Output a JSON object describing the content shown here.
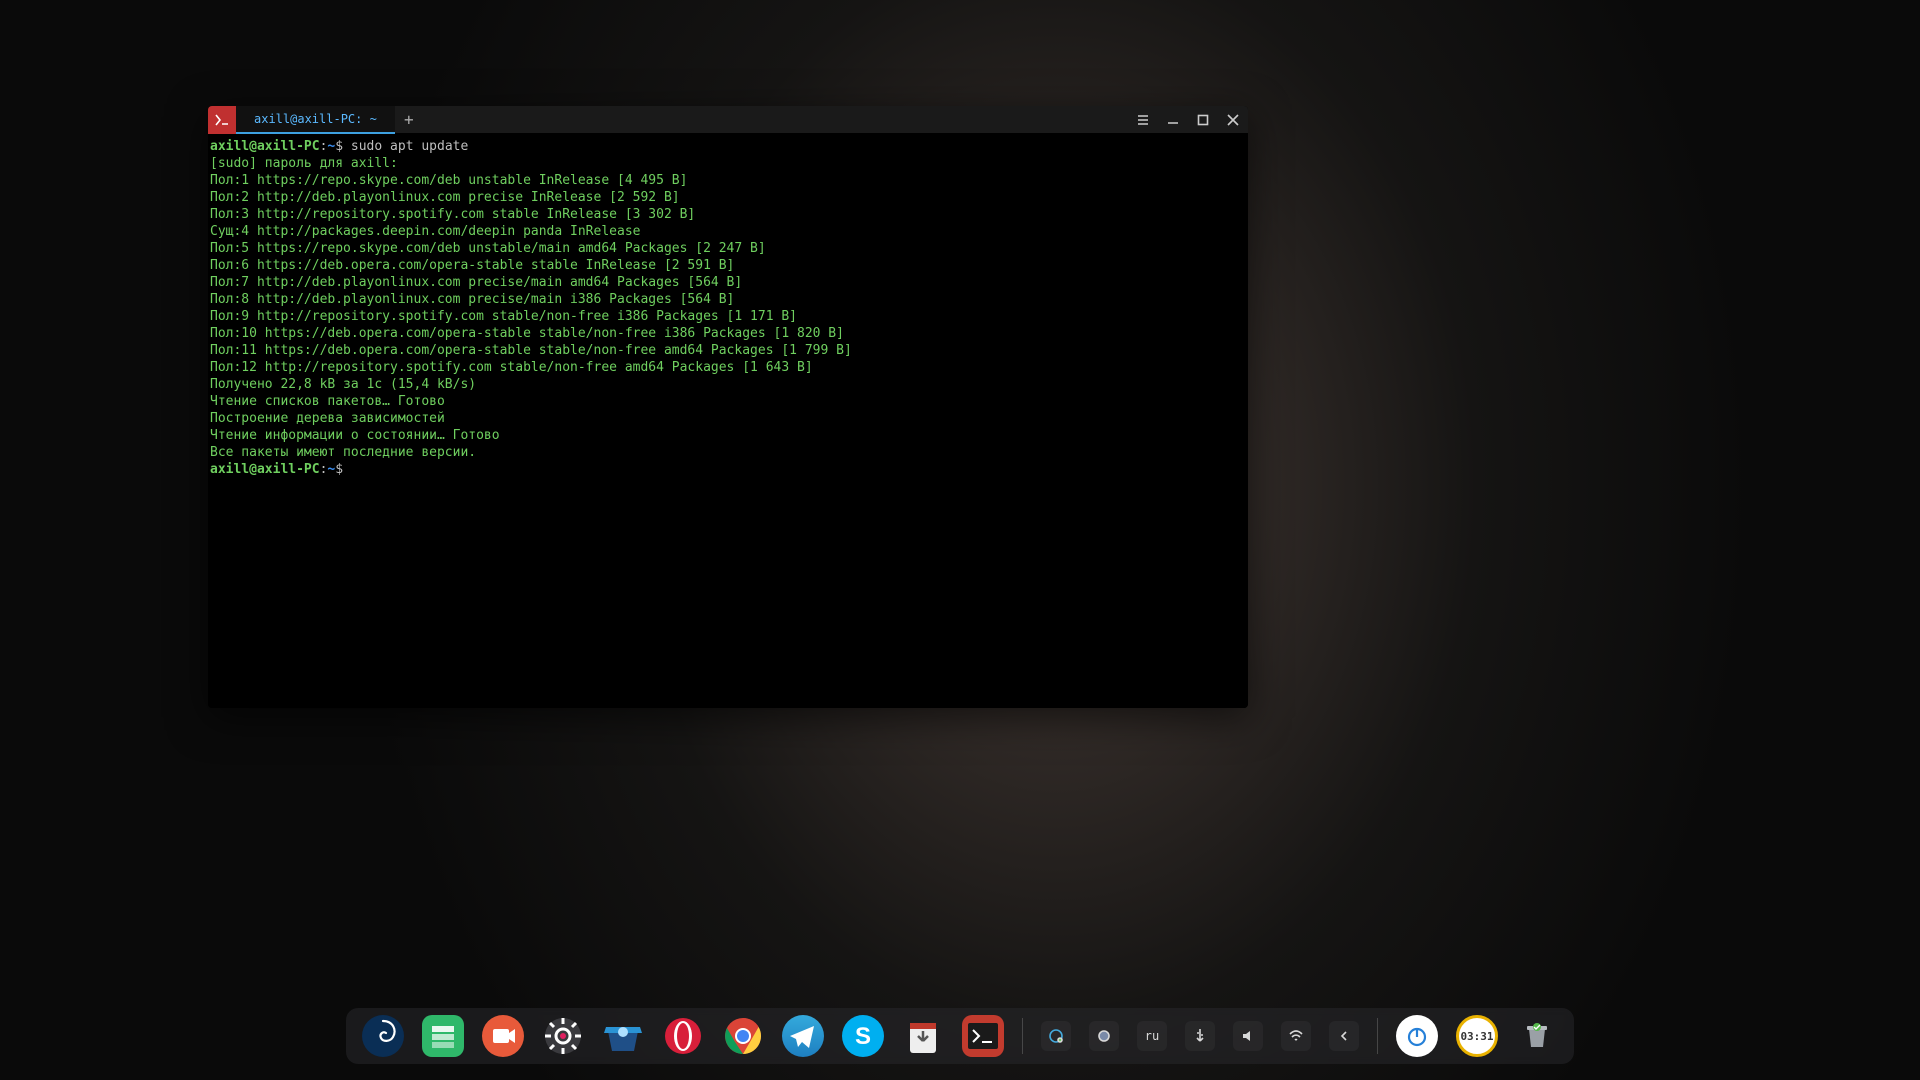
{
  "window": {
    "tab_title": "axill@axill-PC: ~"
  },
  "prompt": {
    "user": "axill",
    "host": "axill-PC",
    "path": "~",
    "symbol": "$"
  },
  "command": "sudo apt update",
  "output_lines": [
    "[sudo] пароль для axill:",
    "Пол:1 https://repo.skype.com/deb unstable InRelease [4 495 B]",
    "Пол:2 http://deb.playonlinux.com precise InRelease [2 592 B]",
    "Пол:3 http://repository.spotify.com stable InRelease [3 302 B]",
    "Сущ:4 http://packages.deepin.com/deepin panda InRelease",
    "Пол:5 https://repo.skype.com/deb unstable/main amd64 Packages [2 247 B]",
    "Пол:6 https://deb.opera.com/opera-stable stable InRelease [2 591 B]",
    "Пол:7 http://deb.playonlinux.com precise/main amd64 Packages [564 B]",
    "Пол:8 http://deb.playonlinux.com precise/main i386 Packages [564 B]",
    "Пол:9 http://repository.spotify.com stable/non-free i386 Packages [1 171 B]",
    "Пол:10 https://deb.opera.com/opera-stable stable/non-free i386 Packages [1 820 B]",
    "Пол:11 https://deb.opera.com/opera-stable stable/non-free amd64 Packages [1 799 B]",
    "Пол:12 http://repository.spotify.com stable/non-free amd64 Packages [1 643 B]",
    "Получено 22,8 kB за 1с (15,4 kB/s)",
    "Чтение списков пакетов… Готово",
    "Построение дерева зависимостей",
    "Чтение информации о состоянии… Готово",
    "Все пакеты имеют последние версии."
  ],
  "tray": {
    "lang": "ru",
    "time": "03:31"
  },
  "dock_items": [
    {
      "name": "deepin-launcher"
    },
    {
      "name": "deepin-file-manager"
    },
    {
      "name": "deepin-screen-recorder"
    },
    {
      "name": "settings"
    },
    {
      "name": "deepin-appstore"
    },
    {
      "name": "opera"
    },
    {
      "name": "chrome"
    },
    {
      "name": "telegram"
    },
    {
      "name": "skype"
    },
    {
      "name": "downloads"
    },
    {
      "name": "terminal"
    }
  ]
}
